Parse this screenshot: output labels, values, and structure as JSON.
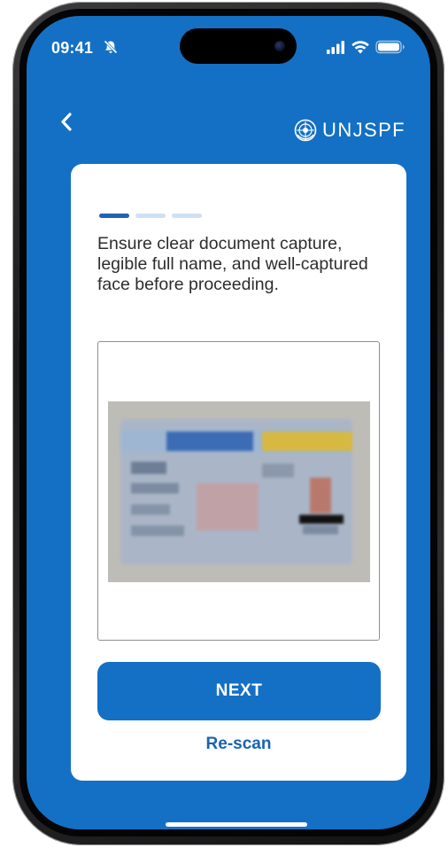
{
  "status_bar": {
    "time": "09:41",
    "icons": [
      "bell-slash-icon",
      "cellular-signal-icon",
      "wifi-icon",
      "battery-icon"
    ]
  },
  "header": {
    "back_icon": "chevron-left-icon",
    "brand_logo": "un-emblem-icon",
    "brand_name": "UNJSPF"
  },
  "progress": {
    "current_step": 1,
    "total_steps": 3
  },
  "card": {
    "instructions": "Ensure clear document capture, legible full name, and well-captured face before proceeding.",
    "document_preview": "blurred-id-card-image",
    "next_label": "NEXT",
    "rescan_label": "Re-scan"
  },
  "colors": {
    "primary": "#1470c4",
    "progress_active": "#1f63b5",
    "progress_inactive": "#cfe0f3",
    "card_background": "#ffffff",
    "text": "#2d2d2d"
  }
}
